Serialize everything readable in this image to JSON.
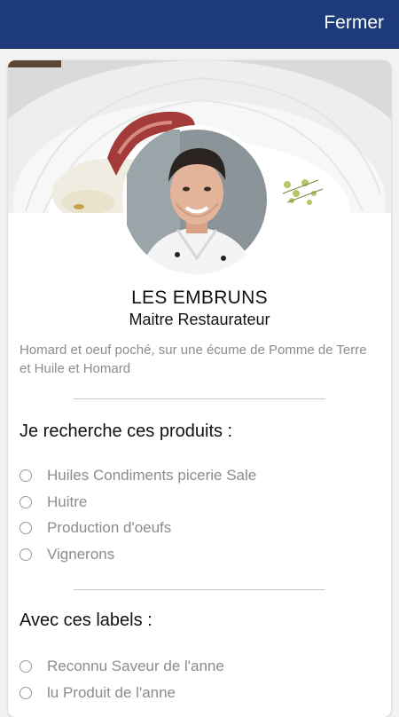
{
  "header": {
    "close_label": "Fermer"
  },
  "profile": {
    "name": "LES EMBRUNS",
    "title": "Maitre Restaurateur",
    "description": "Homard et oeuf poché, sur une écume de Pomme de Terre et Huile et Homard"
  },
  "products": {
    "heading": "Je recherche ces produits :",
    "options": [
      "Huiles Condiments picerie Sale",
      "Huitre",
      "Production d'oeufs",
      "Vignerons"
    ]
  },
  "labels": {
    "heading": "Avec ces labels :",
    "options": [
      "Reconnu Saveur de l'anne",
      "lu Produit de l'anne"
    ]
  },
  "colors": {
    "header_bg": "#1d3a7a",
    "text_muted": "#8c8c8c"
  }
}
